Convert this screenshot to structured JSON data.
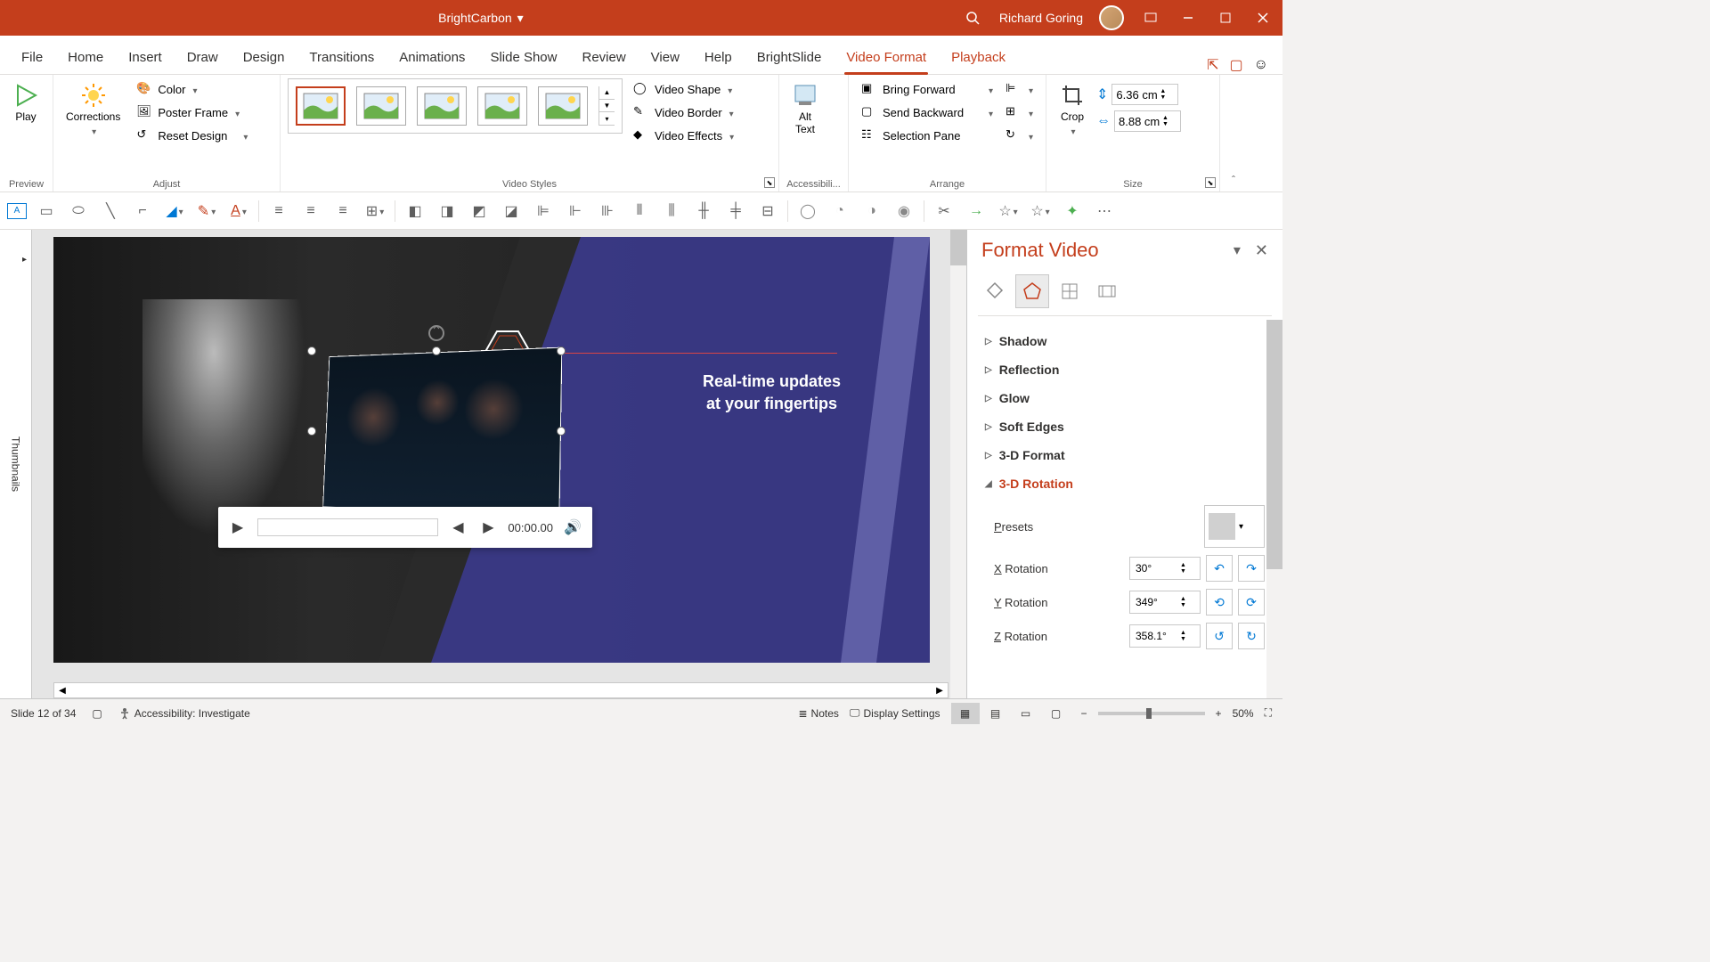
{
  "titlebar": {
    "doc_name": "BrightCarbon",
    "user_name": "Richard Goring"
  },
  "ribbon_tabs": [
    "File",
    "Home",
    "Insert",
    "Draw",
    "Design",
    "Transitions",
    "Animations",
    "Slide Show",
    "Review",
    "View",
    "Help",
    "BrightSlide",
    "Video Format",
    "Playback"
  ],
  "active_tab_index": 12,
  "ribbon": {
    "preview": {
      "play": "Play",
      "label": "Preview"
    },
    "adjust": {
      "corrections": "Corrections",
      "color": "Color",
      "poster_frame": "Poster Frame",
      "reset_design": "Reset Design",
      "label": "Adjust"
    },
    "styles": {
      "video_shape": "Video Shape",
      "video_border": "Video Border",
      "video_effects": "Video Effects",
      "label": "Video Styles"
    },
    "accessibility": {
      "alt_text": "Alt\nText",
      "label": "Accessibili..."
    },
    "arrange": {
      "bring_forward": "Bring Forward",
      "send_backward": "Send Backward",
      "selection_pane": "Selection Pane",
      "label": "Arrange"
    },
    "size": {
      "crop": "Crop",
      "height": "6.36 cm",
      "width": "8.88 cm",
      "label": "Size"
    }
  },
  "thumbnails_label": "Thumbnails",
  "slide": {
    "text_line1": "Real-time updates",
    "text_line2": "at your fingertips",
    "media_time": "00:00.00"
  },
  "format_pane": {
    "title": "Format Video",
    "sections": [
      "Shadow",
      "Reflection",
      "Glow",
      "Soft Edges",
      "3-D Format",
      "3-D Rotation"
    ],
    "active_section_index": 5,
    "presets_label": "Presets",
    "x_rotation_label": "X Rotation",
    "x_rotation": "30°",
    "y_rotation_label": "Y Rotation",
    "y_rotation": "349°",
    "z_rotation_label": "Z Rotation",
    "z_rotation": "358.1°"
  },
  "statusbar": {
    "slide_info": "Slide 12 of 34",
    "accessibility": "Accessibility: Investigate",
    "notes": "Notes",
    "display_settings": "Display Settings",
    "zoom": "50%"
  }
}
